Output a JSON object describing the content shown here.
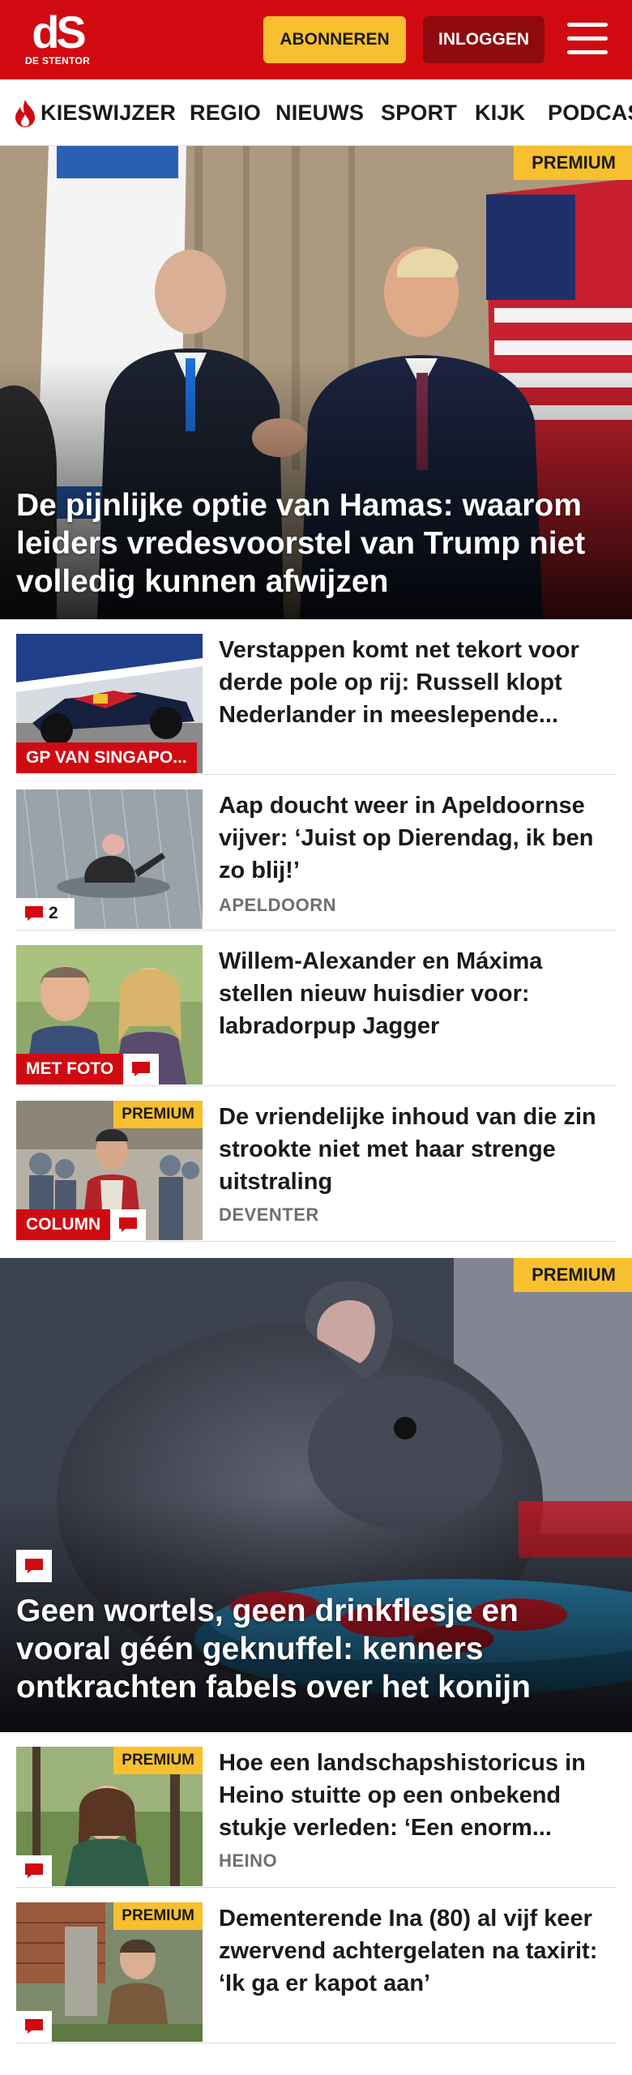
{
  "header": {
    "logo_mark": "dS",
    "logo_text": "DE STENTOR",
    "subscribe_label": "ABONNEREN",
    "login_label": "INLOGGEN"
  },
  "nav": {
    "items": [
      "KIESWIJZER",
      "REGIO",
      "NIEUWS",
      "SPORT",
      "KIJK",
      "PODCAST"
    ]
  },
  "hero1": {
    "badge": "PREMIUM",
    "title": "De pijnlijke optie van Hamas: waarom leiders vredesvoorstel van Trump niet volledig kunnen afwijzen"
  },
  "articles": [
    {
      "title": "Verstappen komt net tekort voor derde pole op rij: Russell klopt Nederlander in meeslepende...",
      "label": "GP VAN SINGAPO..."
    },
    {
      "title": "Aap doucht weer in Apeldoornse vijver: ‘Juist op Dierendag, ik ben zo blij!’",
      "location": "APELDOORN",
      "comments": "2"
    },
    {
      "title": "Willem-Alexander en Máxima stellen nieuw huisdier voor: labradorpup Jagger",
      "label": "MET FOTO"
    },
    {
      "title": "De vriendelijke inhoud van die zin strookte niet met haar strenge uitstraling",
      "location": "DEVENTER",
      "label": "COLUMN",
      "badge": "PREMIUM"
    }
  ],
  "hero2": {
    "badge": "PREMIUM",
    "title": "Geen wortels, geen drinkflesje en vooral géén geknuffel: kenners ontkrachten fabels over het konijn"
  },
  "articles2": [
    {
      "title": "Hoe een landschapshistoricus in Heino stuitte op een onbekend stukje verleden: ‘Een enorm...",
      "location": "HEINO",
      "badge": "PREMIUM"
    },
    {
      "title": "Dementerende Ina (80) al vijf keer zwervend achtergelaten na taxirit: ‘Ik ga er kapot aan’",
      "badge": "PREMIUM"
    }
  ],
  "colors": {
    "brand_red": "#d10a11",
    "dark_red": "#8f0a0e",
    "premium_yellow": "#f8c02e",
    "location_gray": "#6f6f6f"
  },
  "icons": [
    "flame-icon",
    "menu-icon",
    "comment-icon"
  ]
}
